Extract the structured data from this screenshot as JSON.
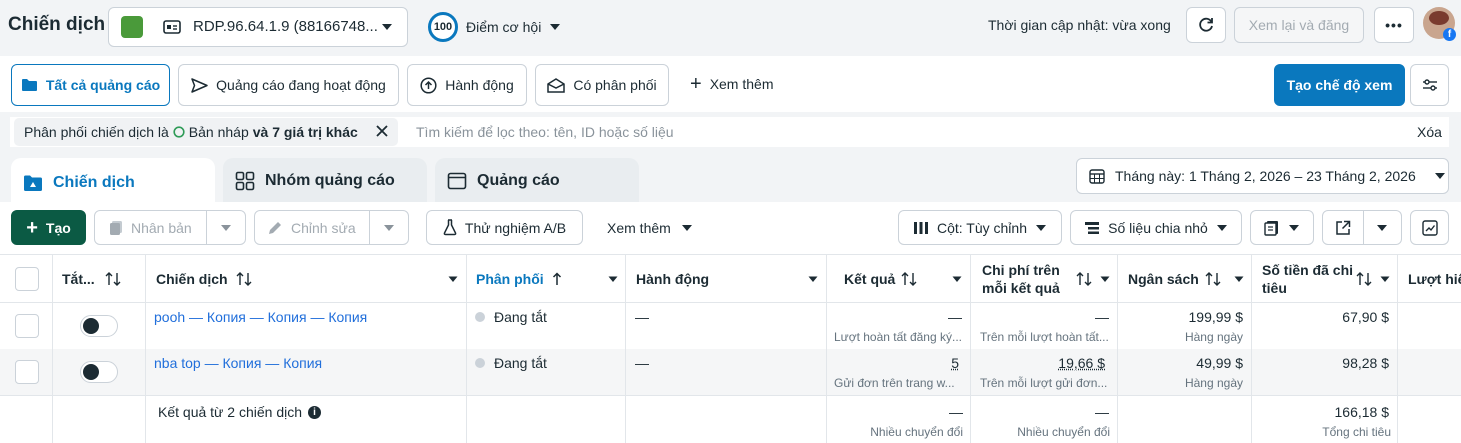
{
  "header": {
    "title": "Chiến dịch",
    "account_label": "RDP.96.64.1.9 (88166748...",
    "score_value": "100",
    "score_label": "Điểm cơ hội",
    "update_status": "Thời gian cập nhật: vừa xong",
    "review_publish_label": "Xem lại và đăng"
  },
  "filters": {
    "all_ads": "Tất cả quảng cáo",
    "active_ads": "Quảng cáo đang hoạt động",
    "actions": "Hành động",
    "has_delivery": "Có phân phối",
    "see_more": "Xem thêm",
    "create_view": "Tạo chế độ xem"
  },
  "filter_chip": {
    "prefix": "Phân phối chiến dịch là",
    "value": "Bản nháp",
    "suffix": "và 7 giá trị khác",
    "search_placeholder": "Tìm kiếm để lọc theo: tên, ID hoặc số liệu",
    "clear_label": "Xóa"
  },
  "tabs": [
    {
      "label": "Chiến dịch"
    },
    {
      "label": "Nhóm quảng cáo"
    },
    {
      "label": "Quảng cáo"
    }
  ],
  "date_range": "Tháng này: 1 Tháng 2, 2026 – 23 Tháng 2, 2026",
  "toolbar": {
    "create": "Tạo",
    "duplicate": "Nhân bản",
    "edit": "Chỉnh sửa",
    "ab_test": "Thử nghiệm A/B",
    "more": "Xem thêm",
    "columns": "Cột: Tùy chỉnh",
    "breakdown": "Số liệu chia nhỏ"
  },
  "table": {
    "headers": {
      "toggle": "Tắt...",
      "campaign": "Chiến dịch",
      "delivery": "Phân phối",
      "actions": "Hành động",
      "results": "Kết quả",
      "cost_per_result_1": "Chi phí trên",
      "cost_per_result_2": "mỗi kết quả",
      "budget": "Ngân sách",
      "amount_spent_1": "Số tiền đã chi",
      "amount_spent_2": "tiêu",
      "reach": "Lượt hiể"
    },
    "rows": [
      {
        "name": "pooh — Копия — Копия — Копия",
        "delivery": "Đang tắt",
        "actions": "—",
        "result_value": "—",
        "result_sub": "Lượt hoàn tất đăng ký...",
        "cost_value": "—",
        "cost_sub": "Trên mỗi lượt hoàn tất...",
        "budget_value": "199,99 $",
        "budget_sub": "Hàng ngày",
        "spent_value": "67,90 $"
      },
      {
        "name": "nba top — Копия — Копия",
        "delivery": "Đang tắt",
        "actions": "—",
        "result_value": "5",
        "result_sub": "Gửi đơn trên trang w...",
        "cost_value": "19,66 $",
        "cost_sub": "Trên mỗi lượt gửi đơn...",
        "budget_value": "49,99 $",
        "budget_sub": "Hàng ngày",
        "spent_value": "98,28 $"
      }
    ],
    "summary": {
      "label": "Kết quả từ 2 chiến dịch",
      "result_value": "—",
      "result_sub": "Nhiều chuyển đổi",
      "cost_value": "—",
      "cost_sub": "Nhiều chuyển đổi",
      "spent_value": "166,18 $",
      "spent_sub": "Tổng chi tiêu"
    }
  },
  "colors": {
    "primary": "#0a78be",
    "create_green": "#0b5a44",
    "link": "#216fdb"
  }
}
